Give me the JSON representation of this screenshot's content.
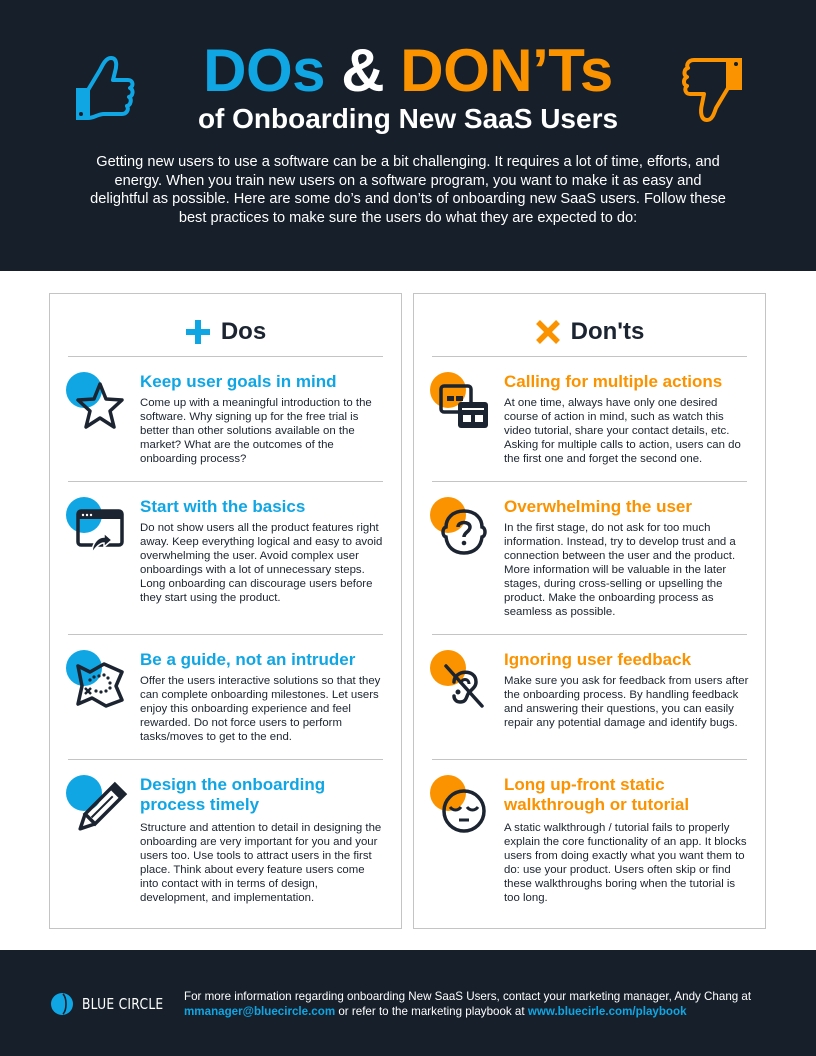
{
  "header": {
    "title_dos": "DOs",
    "title_amp": "&",
    "title_donts": "DON’Ts",
    "subtitle": "of Onboarding New SaaS Users",
    "intro": "Getting new users to use a software can be a bit challenging. It requires a lot of time, efforts, and energy. When you train new users on a software program, you want to make it as easy and delightful as possible. Here are some do’s and don’ts of onboarding new SaaS users. Follow these best practices to make sure the users do what they are expected to do:",
    "icons": {
      "left": "thumbs-up-icon",
      "right": "thumbs-down-icon"
    }
  },
  "colors": {
    "dark_bg": "#161f2a",
    "blue": "#10a6e4",
    "orange": "#fb9300",
    "text_dark": "#1b2430",
    "border": "#c4c4c4"
  },
  "dos": {
    "heading": "Dos",
    "heading_icon": "plus-icon",
    "items": [
      {
        "icon": "star-icon",
        "title": "Keep user goals in mind",
        "text": "Come up with a meaningful introduction to the software. Why signing up for the free trial is better than other solutions available on the market? What are the outcomes of the onboarding process?"
      },
      {
        "icon": "browser-upload-icon",
        "title": "Start with the basics",
        "text": "Do not show users all the product features right away. Keep everything logical and easy to avoid overwhelming the user. Avoid complex user onboardings with a lot of unnecessary steps. Long onboarding can discourage users before they start using the product."
      },
      {
        "icon": "treasure-map-icon",
        "title": "Be a guide, not an intruder",
        "text": "Offer the users interactive solutions so that they can complete onboarding milestones. Let users enjoy this onboarding experience and feel rewarded. Do not force users to perform tasks/moves to get to the end."
      },
      {
        "icon": "pencil-icon",
        "title": "Design the onboarding process timely",
        "text": "Structure and attention to detail in designing the onboarding are very important for you and your users too. Use tools to attract users in the first place. Think about every feature users come into contact with in terms of design, development, and implementation."
      }
    ]
  },
  "donts": {
    "heading": "Don'ts",
    "heading_icon": "cross-icon",
    "items": [
      {
        "icon": "multiple-windows-icon",
        "title": "Calling for multiple actions",
        "text": "At one time, always have only one desired course of action in mind, such as watch this video tutorial, share your contact details, etc. Asking for multiple calls to action, users can do the first one and forget the second one."
      },
      {
        "icon": "confused-head-icon",
        "title": "Overwhelming the user",
        "text": "In the first stage, do not ask for too much information. Instead, try to develop trust and a connection between the user and the product. More information will be valuable in the later stages, during cross-selling or upselling the product. Make the onboarding process as seamless as possible."
      },
      {
        "icon": "deaf-ear-icon",
        "title": "Ignoring user feedback",
        "text": "Make sure you ask for feedback from users after the onboarding process. By handling feedback and answering their questions, you can easily repair any potential damage and identify bugs."
      },
      {
        "icon": "sleepy-face-icon",
        "title": "Long up-front static walkthrough or tutorial",
        "text": "A static walkthrough / tutorial fails to properly explain the core functionality of an app. It blocks users from doing exactly what you want them to do: use your product. Users often skip or find these walkthroughs boring when the tutorial is too long."
      }
    ]
  },
  "footer": {
    "logo_text": "BLUE CIRCLE",
    "logo_icon": "blue-circle-logo-icon",
    "text_1": "For more information regarding onboarding New SaaS Users, contact your marketing manager, Andy Chang at ",
    "email": "mmanager@bluecircle.com",
    "text_2": " or refer to the marketing playbook at ",
    "link": "www.bluecirle.com/playbook"
  }
}
